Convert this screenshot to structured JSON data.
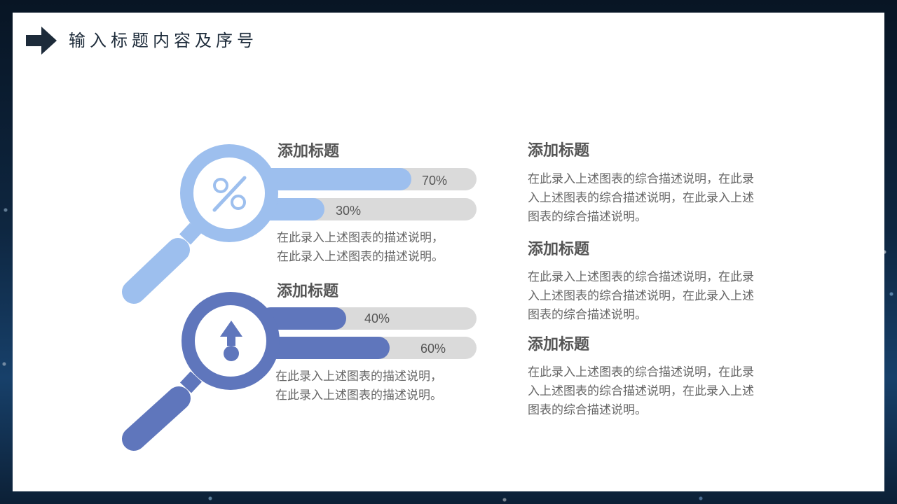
{
  "page": {
    "title": "输入标题内容及序号"
  },
  "colors": {
    "light_blue": "#9dbfee",
    "dark_blue": "#5f76bc",
    "track_gray": "#dadada",
    "title_dark": "#1d2b3a"
  },
  "groups": [
    {
      "icon": "percent-icon",
      "heading": "添加标题",
      "bars": [
        {
          "label": "70%",
          "value": 0.7
        },
        {
          "label": "30%",
          "value": 0.3
        }
      ],
      "desc_line1": "在此录入上述图表的描述说明，",
      "desc_line2": "在此录入上述图表的描述说明。"
    },
    {
      "icon": "arrow-up-icon",
      "heading": "添加标题",
      "bars": [
        {
          "label": "40%",
          "value": 0.4
        },
        {
          "label": "60%",
          "value": 0.6
        }
      ],
      "desc_line1": "在此录入上述图表的描述说明，",
      "desc_line2": "在此录入上述图表的描述说明。"
    }
  ],
  "right_items": [
    {
      "heading": "添加标题",
      "line1": "在此录入上述图表的综合描述说明，在此录",
      "line2": "入上述图表的综合描述说明，在此录入上述",
      "line3": "图表的综合描述说明。"
    },
    {
      "heading": "添加标题",
      "line1": "在此录入上述图表的综合描述说明，在此录",
      "line2": "入上述图表的综合描述说明，在此录入上述",
      "line3": "图表的综合描述说明。"
    },
    {
      "heading": "添加标题",
      "line1": "在此录入上述图表的综合描述说明，在此录",
      "line2": "入上述图表的综合描述说明，在此录入上述",
      "line3": "图表的综合描述说明。"
    }
  ]
}
